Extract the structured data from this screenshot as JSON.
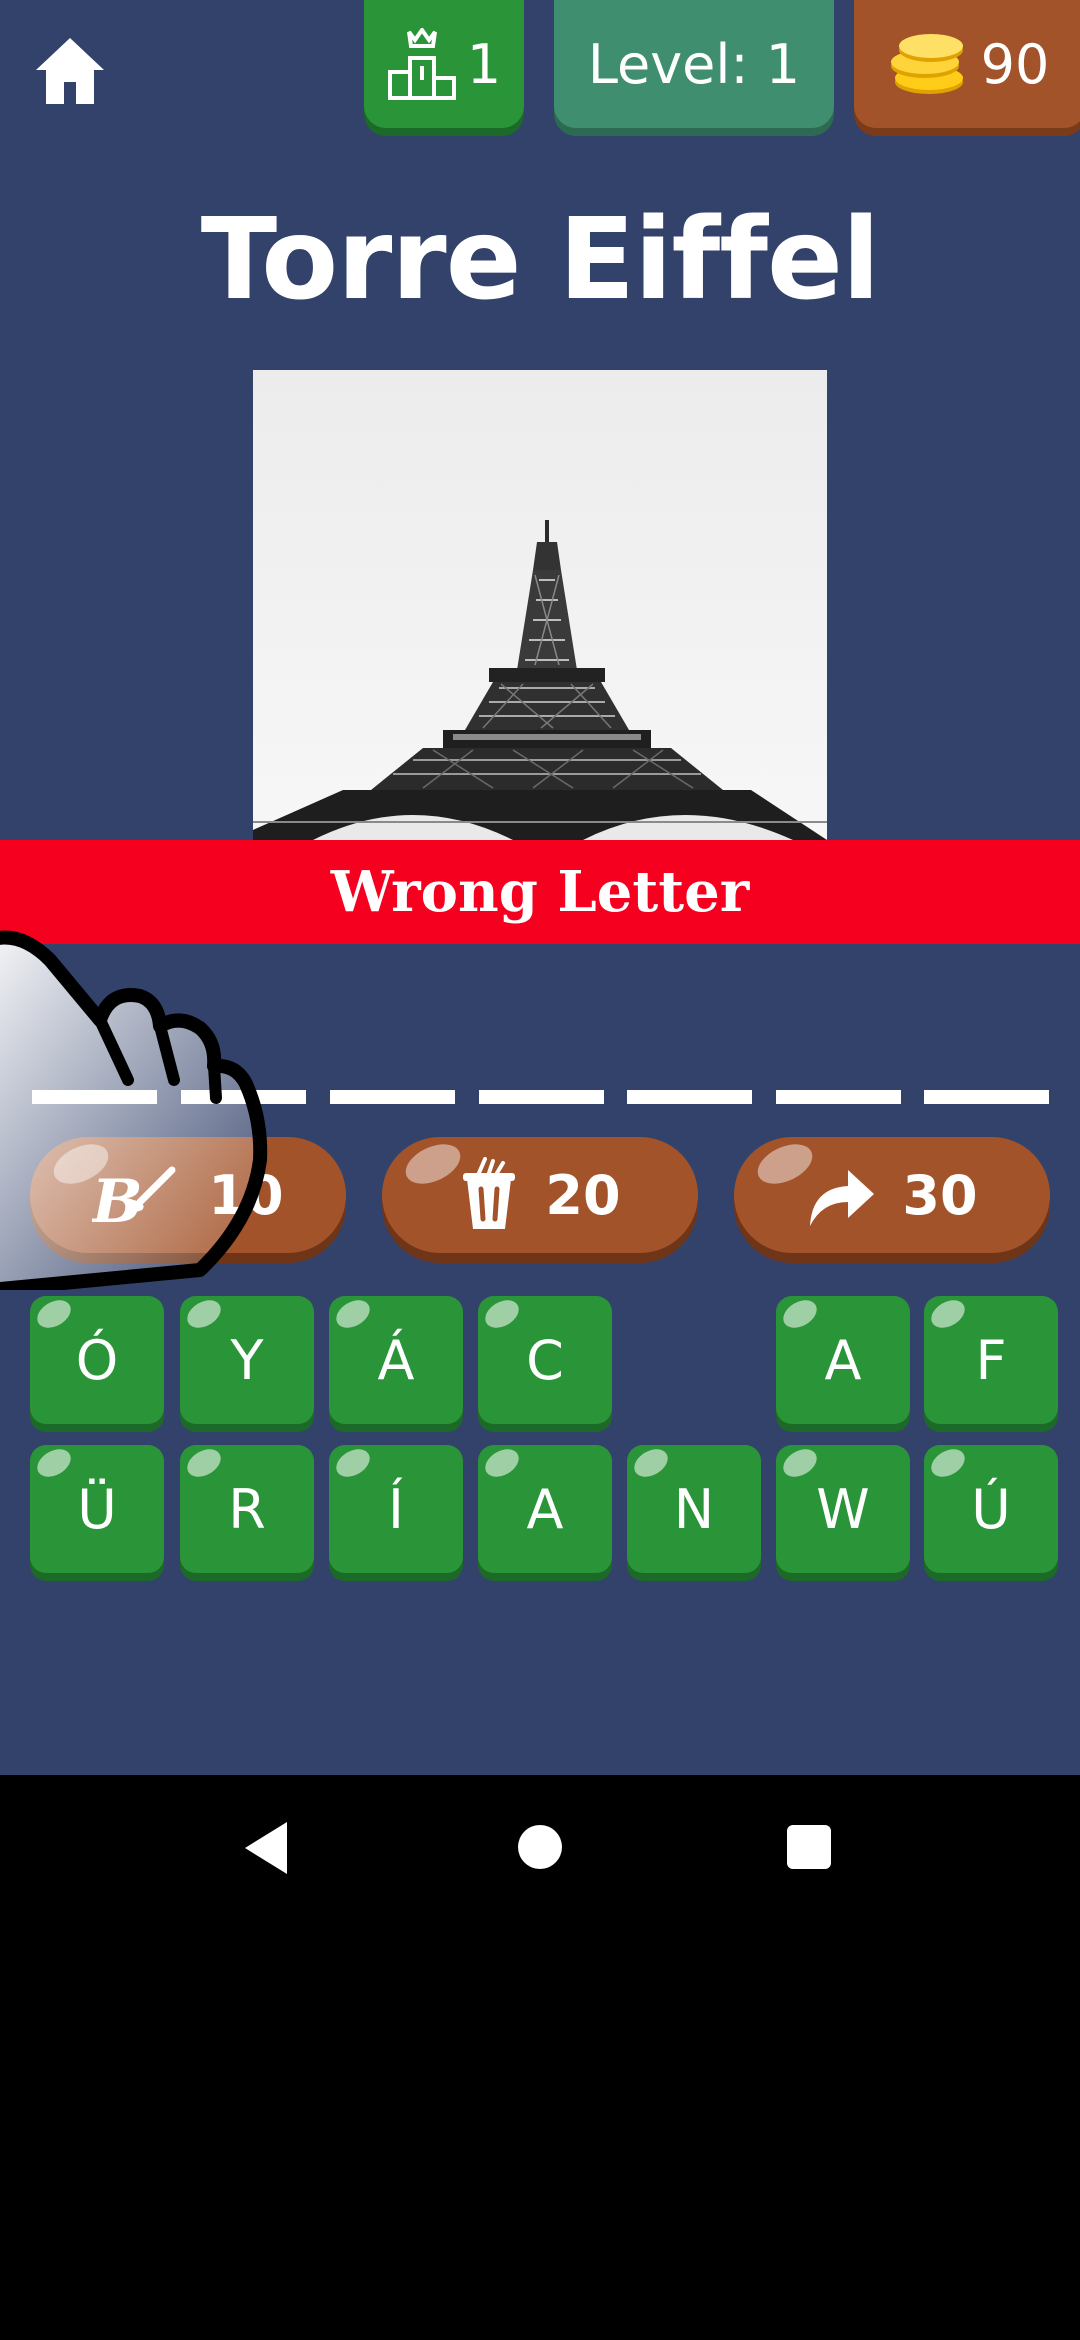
{
  "header": {
    "home_icon": "home-icon",
    "trophy_icon": "podium-trophy-icon",
    "rank": "1",
    "level_text": "Level: 1",
    "coins_icon": "gold-coins-icon",
    "coins": "90"
  },
  "question": {
    "title": "Torre Eiffel",
    "image": "eiffel-tower-photo"
  },
  "feedback": {
    "message": "Wrong Letter",
    "color": "#f5001f"
  },
  "answer": {
    "slot_count": 7
  },
  "hints": [
    {
      "icon": "reveal-letter-brush-icon",
      "cost": "10"
    },
    {
      "icon": "remove-letters-bin-icon",
      "cost": "20"
    },
    {
      "icon": "skip-arrow-icon",
      "cost": "30"
    }
  ],
  "keyboard": {
    "row1": [
      "Ó",
      "Y",
      "Á",
      "C",
      "",
      "A",
      "F"
    ],
    "row2": [
      "Ü",
      "R",
      "Í",
      "A",
      "N",
      "W",
      "Ú"
    ]
  },
  "colors": {
    "background": "#33426b",
    "key_green": "#2a9438",
    "hint_brown": "#a3532a",
    "level_teal": "#3e8e6f"
  },
  "navbar": {
    "back_icon": "back-triangle-icon",
    "home_icon": "home-circle-icon",
    "recents_icon": "recents-square-icon"
  }
}
